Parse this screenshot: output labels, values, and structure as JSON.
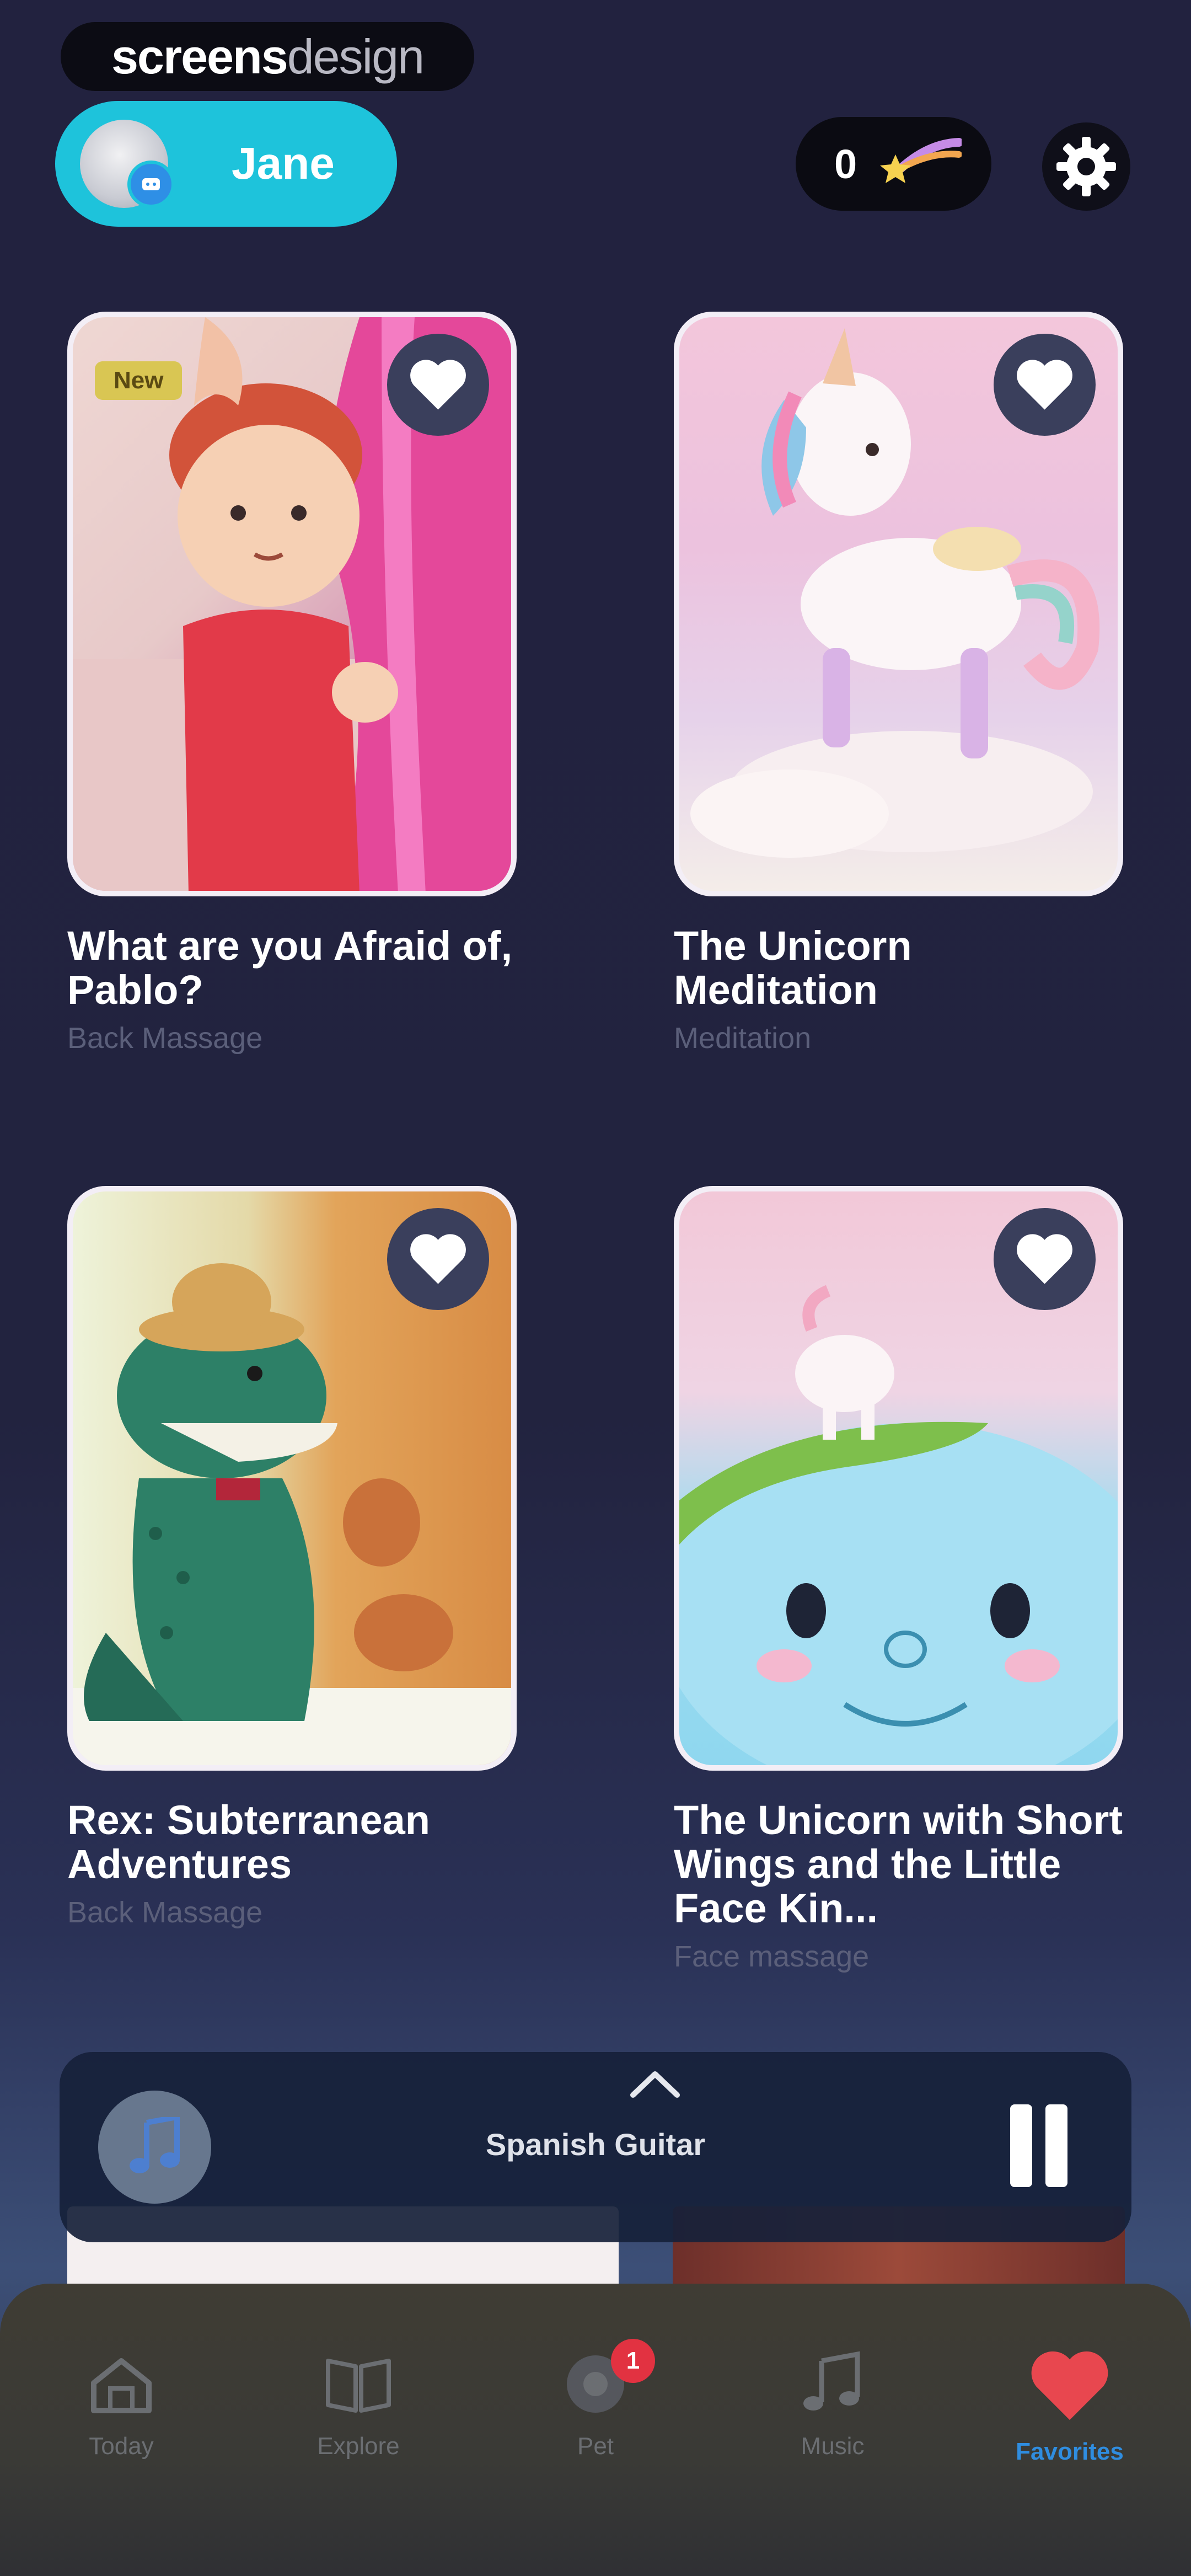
{
  "watermark": {
    "strong": "screens",
    "light": "design"
  },
  "profile": {
    "name": "Jane"
  },
  "coins": {
    "count": "0"
  },
  "cards": [
    {
      "title": "What are you Afraid of, Pablo?",
      "subtitle": "Back Massage",
      "badge": "New",
      "favorite": true
    },
    {
      "title": "The Unicorn Meditation",
      "subtitle": "Meditation",
      "favorite": true
    },
    {
      "title": "Rex: Subterranean Adventures",
      "subtitle": "Back Massage",
      "favorite": true
    },
    {
      "title": "The Unicorn with Short Wings and the Little Face Kin...",
      "subtitle": "Face massage",
      "favorite": true
    }
  ],
  "player": {
    "track": "Spanish Guitar",
    "state": "playing"
  },
  "nav": {
    "items": [
      {
        "label": "Today",
        "icon": "house-icon"
      },
      {
        "label": "Explore",
        "icon": "book-icon"
      },
      {
        "label": "Pet",
        "icon": "pet-icon",
        "badge": "1"
      },
      {
        "label": "Music",
        "icon": "music-note-icon"
      },
      {
        "label": "Favorites",
        "icon": "heart-icon",
        "active": true
      }
    ]
  },
  "colors": {
    "background": "#22223f",
    "accent_cyan": "#1ec3db",
    "active_blue": "#2f8de0",
    "heart_red": "#e8474f",
    "badge_red": "#e23241"
  }
}
